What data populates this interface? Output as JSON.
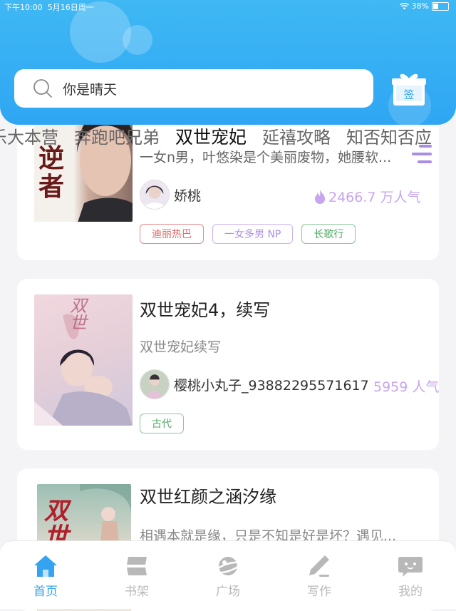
{
  "status_bar": {
    "time": "下午10:00",
    "date": "5月16日周一",
    "battery": "38%"
  },
  "search": {
    "query": "你是晴天"
  },
  "checkin": {
    "label": "签"
  },
  "tabs": [
    "乐大本营",
    "奔跑吧兄弟",
    "双世宠妃",
    "延禧攻略",
    "知否知否应"
  ],
  "active_tab": "双世宠妃",
  "cards": [
    {
      "cover_text": "逆者",
      "desc": "一女n男，叶悠染是个美丽废物，她腰软...",
      "author": "娇桃",
      "popularity": "2466.7 万人气",
      "tags": [
        "迪丽热巴",
        "一女多男 NP",
        "长歌行"
      ]
    },
    {
      "title": "双世宠妃4，续写",
      "desc": "双世宠妃续写",
      "author": "樱桃小丸子_93882295571617",
      "popularity": "5959 人气",
      "tags": [
        "古代"
      ]
    },
    {
      "title": "双世红颜之涵汐缘",
      "desc": "相遇本就是缘，只是不知是好是坏？遇见..."
    }
  ],
  "nav": [
    "首页",
    "书架",
    "广场",
    "写作",
    "我的"
  ],
  "colors": {
    "accent": "#35a3f0",
    "popularity": "#c7a6ee",
    "header": "#3fb8f4"
  }
}
